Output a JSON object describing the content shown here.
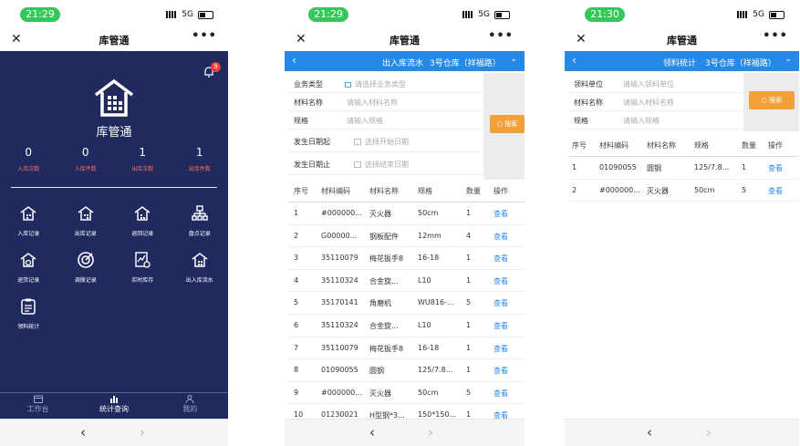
{
  "p1": {
    "time": "21:29",
    "network": "5G",
    "title": "库管通",
    "badge": "9",
    "brand": "库管通",
    "stats": [
      {
        "value": "0",
        "label": "入库次数"
      },
      {
        "value": "0",
        "label": "入库件数"
      },
      {
        "value": "1",
        "label": "出库次数"
      },
      {
        "value": "1",
        "label": "出库件数"
      }
    ],
    "menu": [
      {
        "label": "入库记录",
        "icon": "inbound-icon"
      },
      {
        "label": "出库记录",
        "icon": "outbound-icon"
      },
      {
        "label": "退回记录",
        "icon": "return-icon"
      },
      {
        "label": "盘点记录",
        "icon": "inventory-tree-icon"
      },
      {
        "label": "退货记录",
        "icon": "refund-icon"
      },
      {
        "label": "调拨记录",
        "icon": "target-icon"
      },
      {
        "label": "实时库存",
        "icon": "stock-chart-icon"
      },
      {
        "label": "出入库流水",
        "icon": "flow-icon"
      },
      {
        "label": "领料统计",
        "icon": "clipboard-icon"
      }
    ],
    "tabs": [
      {
        "label": "工作台"
      },
      {
        "label": "统计查询"
      },
      {
        "label": "我的"
      }
    ]
  },
  "p2": {
    "time": "21:29",
    "network": "5G",
    "title": "库管通",
    "bar_title": "出入库流水",
    "warehouse": "3号仓库（祥福路）",
    "fields": [
      {
        "label": "业务类型",
        "placeholder": "请选择业务类型"
      },
      {
        "label": "材料名称",
        "placeholder": "请输入材料名称"
      },
      {
        "label": "规格",
        "placeholder": "请输入规格"
      },
      {
        "label": "发生日期起",
        "placeholder": "选择开始日期"
      },
      {
        "label": "发生日期止",
        "placeholder": "选择结束日期"
      }
    ],
    "search": "搜索",
    "headers": [
      "序号",
      "材料编码",
      "材料名称",
      "规格",
      "数量",
      "操作"
    ],
    "rows": [
      [
        "1",
        "#000000...",
        "灭火器",
        "50cm",
        "1",
        "查看"
      ],
      [
        "2",
        "G00000...",
        "钢板配件",
        "12mm",
        "4",
        "查看"
      ],
      [
        "3",
        "35110079",
        "梅花扳手8",
        "16-18",
        "1",
        "查看"
      ],
      [
        "4",
        "35110324",
        "合金旋...",
        "L10",
        "1",
        "查看"
      ],
      [
        "5",
        "35170141",
        "角磨机",
        "WU816-...",
        "5",
        "查看"
      ],
      [
        "6",
        "35110324",
        "合金旋...",
        "L10",
        "1",
        "查看"
      ],
      [
        "7",
        "35110079",
        "梅花扳手8",
        "16-18",
        "1",
        "查看"
      ],
      [
        "8",
        "01090055",
        "圆钢",
        "125/7.8...",
        "1",
        "查看"
      ],
      [
        "9",
        "#000000...",
        "灭火器",
        "50cm",
        "5",
        "查看"
      ],
      [
        "10",
        "01230021",
        "H型钢*3...",
        "150*150...",
        "1",
        "查看"
      ]
    ]
  },
  "p3": {
    "time": "21:30",
    "network": "5G",
    "title": "库管通",
    "bar_title": "领料统计",
    "warehouse": "3号仓库（祥福路）",
    "fields": [
      {
        "label": "领料单位",
        "placeholder": "请输入领料单位"
      },
      {
        "label": "材料名称",
        "placeholder": "请输入材料名称"
      },
      {
        "label": "规格",
        "placeholder": "请输入规格"
      }
    ],
    "search": "搜索",
    "headers": [
      "序号",
      "材料编码",
      "材料名称",
      "规格",
      "数量",
      "操作"
    ],
    "rows": [
      [
        "1",
        "01090055",
        "圆钢",
        "125/7.8...",
        "1",
        "查看"
      ],
      [
        "2",
        "#000000...",
        "灭火器",
        "50cm",
        "5",
        "查看"
      ]
    ]
  }
}
